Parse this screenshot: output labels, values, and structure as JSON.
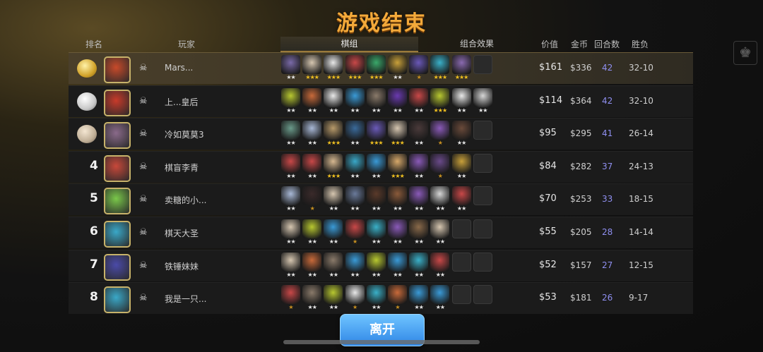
{
  "title": "游戏结束",
  "headers": {
    "rank": "排名",
    "player": "玩家",
    "lineup_tab": "棋组",
    "synergy_tab": "组合效果",
    "value": "价值",
    "gold": "金币",
    "rounds": "回合数",
    "winloss": "胜负"
  },
  "colors": {
    "accent": "#f3a93a",
    "rounds": "#8f8ff0",
    "button": "#2f86e6"
  },
  "rows": [
    {
      "rank": "",
      "medal": "gold",
      "name": "Mars...",
      "value": "$161",
      "gold": "$336",
      "rounds": "42",
      "wl": "32-10",
      "stars": [
        "★★",
        "★★★",
        "★★★",
        "★★★",
        "★★★",
        "★★",
        "★",
        "★★★",
        "★★★",
        ""
      ]
    },
    {
      "rank": "",
      "medal": "silver",
      "name": "上...皇后",
      "value": "$114",
      "gold": "$364",
      "rounds": "42",
      "wl": "32-10",
      "stars": [
        "★★",
        "★★",
        "★★",
        "★★",
        "★★",
        "★★",
        "★★",
        "★★★",
        "★★",
        "★★"
      ]
    },
    {
      "rank": "",
      "medal": "bronze",
      "name": "冷如莫莫3",
      "value": "$95",
      "gold": "$295",
      "rounds": "41",
      "wl": "26-14",
      "stars": [
        "★★",
        "★★",
        "★★★",
        "★★",
        "★★★",
        "★★★",
        "★★",
        "★",
        "★★",
        ""
      ]
    },
    {
      "rank": "4",
      "medal": "",
      "name": "棋盲李青",
      "value": "$84",
      "gold": "$282",
      "rounds": "37",
      "wl": "24-13",
      "stars": [
        "★★",
        "★★",
        "★★★",
        "★★",
        "★★",
        "★★★",
        "★★",
        "★",
        "★★",
        ""
      ]
    },
    {
      "rank": "5",
      "medal": "",
      "name": "卖糖的小...",
      "value": "$70",
      "gold": "$253",
      "rounds": "33",
      "wl": "18-15",
      "stars": [
        "★★",
        "★",
        "★★",
        "★★",
        "★★",
        "★★",
        "★★",
        "★★",
        "★★",
        ""
      ]
    },
    {
      "rank": "6",
      "medal": "",
      "name": "棋天大圣",
      "value": "$55",
      "gold": "$205",
      "rounds": "28",
      "wl": "14-14",
      "stars": [
        "★★",
        "★★",
        "★★",
        "★",
        "★★",
        "★★",
        "★★",
        "★★",
        "",
        ""
      ]
    },
    {
      "rank": "7",
      "medal": "",
      "name": "铁锤妹妹",
      "value": "$52",
      "gold": "$157",
      "rounds": "27",
      "wl": "12-15",
      "stars": [
        "★★",
        "★★",
        "★★",
        "★★",
        "★★",
        "★★",
        "★★",
        "★★",
        "",
        ""
      ]
    },
    {
      "rank": "8",
      "medal": "",
      "name": "我是一只...",
      "value": "$53",
      "gold": "$181",
      "rounds": "26",
      "wl": "9-17",
      "stars": [
        "★",
        "★★",
        "★★",
        "★",
        "★★",
        "★",
        "★★",
        "★★",
        "",
        ""
      ]
    }
  ],
  "leave_button": "离开"
}
